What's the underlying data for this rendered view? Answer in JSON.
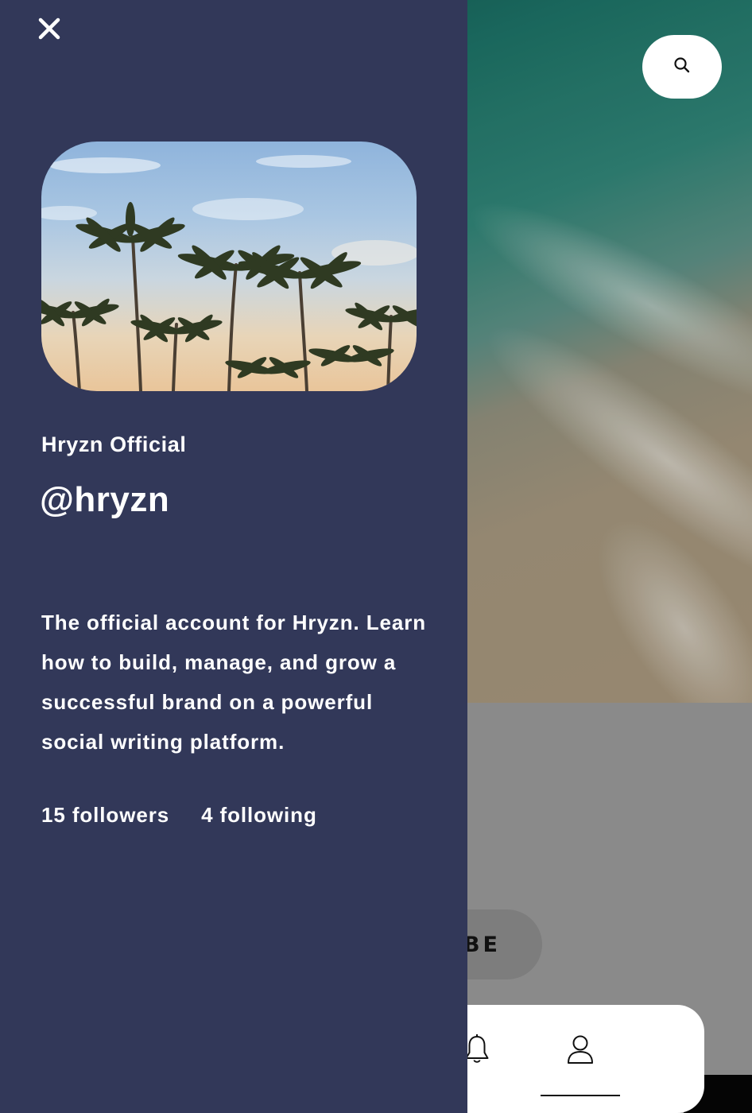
{
  "background": {
    "subscribe_label_visible": "BE",
    "search_button": {
      "icon": "search-icon"
    },
    "bottom_nav": {
      "items": [
        {
          "name": "notifications",
          "icon": "bell-icon"
        },
        {
          "name": "profile",
          "icon": "user-icon",
          "active": true
        }
      ]
    }
  },
  "drawer": {
    "close_icon": "close-icon",
    "cover_image": "palm-trees-photo",
    "display_name": "Hryzn Official",
    "handle": "@hryzn",
    "bio": "The official account for Hryzn. Learn how to build, manage, and grow a successful brand on a powerful social writing platform.",
    "stats": {
      "followers": "15 followers",
      "following": "4 following"
    }
  },
  "colors": {
    "drawer_bg": "#323859",
    "overlay_gray": "#8a8a8a",
    "text": "#ffffff"
  }
}
